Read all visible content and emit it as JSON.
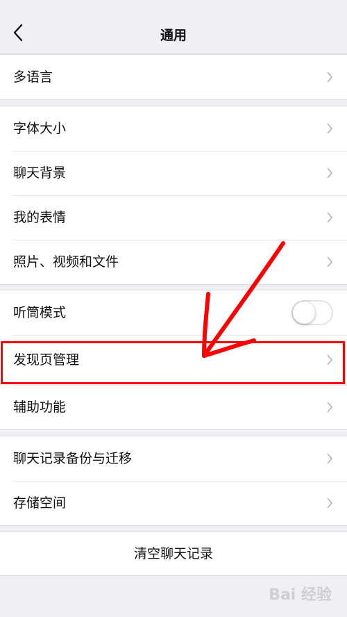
{
  "header": {
    "title": "通用",
    "back_icon": "chevron-left-icon"
  },
  "groups": [
    {
      "items": [
        {
          "label": "多语言"
        }
      ]
    },
    {
      "items": [
        {
          "label": "字体大小"
        },
        {
          "label": "聊天背景"
        },
        {
          "label": "我的表情"
        },
        {
          "label": "照片、视频和文件"
        }
      ]
    },
    {
      "items": [
        {
          "label": "听筒模式",
          "toggle": false
        },
        {
          "label": "发现页管理"
        },
        {
          "label": "辅助功能"
        }
      ]
    },
    {
      "items": [
        {
          "label": "聊天记录备份与迁移"
        },
        {
          "label": "存储空间"
        }
      ]
    }
  ],
  "clear_button": {
    "label": "清空聊天记录"
  },
  "annotation": {
    "color": "#ff0000"
  },
  "watermark": {
    "text": "Bai 经验"
  }
}
